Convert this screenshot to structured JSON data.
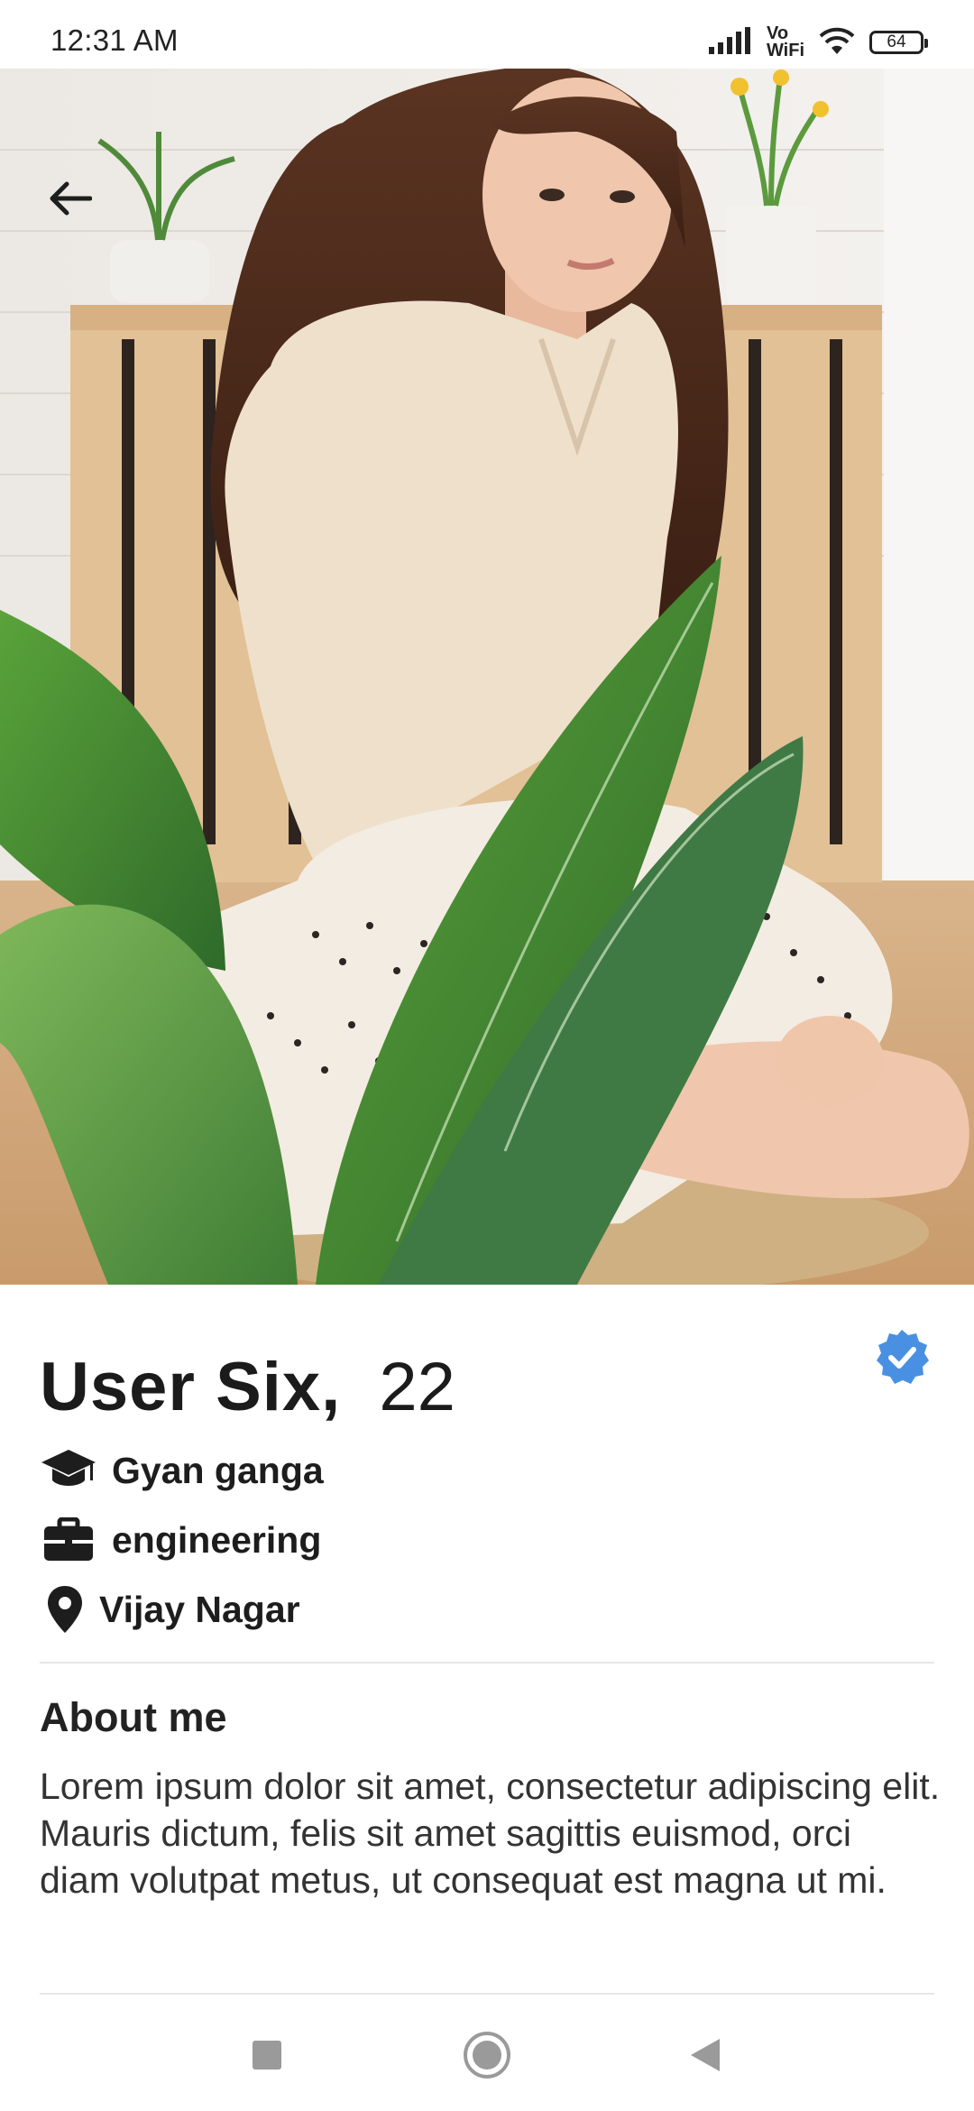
{
  "status_bar": {
    "time": "12:31 AM",
    "network_label_top": "Vo",
    "network_label_bottom": "WiFi",
    "battery": "64"
  },
  "header": {
    "back_icon": "arrow-left-icon"
  },
  "profile": {
    "name": "User  Six,",
    "age": "22",
    "verified_icon": "verified-badge-icon",
    "verified_color": "#4a90e2",
    "education": {
      "icon": "graduation-cap-icon",
      "text": "Gyan ganga"
    },
    "work": {
      "icon": "briefcase-icon",
      "text": "engineering"
    },
    "location": {
      "icon": "location-pin-icon",
      "text": "Vijay Nagar"
    }
  },
  "about": {
    "heading": "About me",
    "body": "Lorem ipsum dolor sit amet, consectetur adipiscing elit. Mauris dictum, felis sit amet sagittis euismod, orci diam volutpat metus, ut consequat est magna ut mi."
  },
  "nav": {
    "recent_icon": "square-recents-icon",
    "home_icon": "circle-home-icon",
    "back_icon": "triangle-back-icon"
  }
}
